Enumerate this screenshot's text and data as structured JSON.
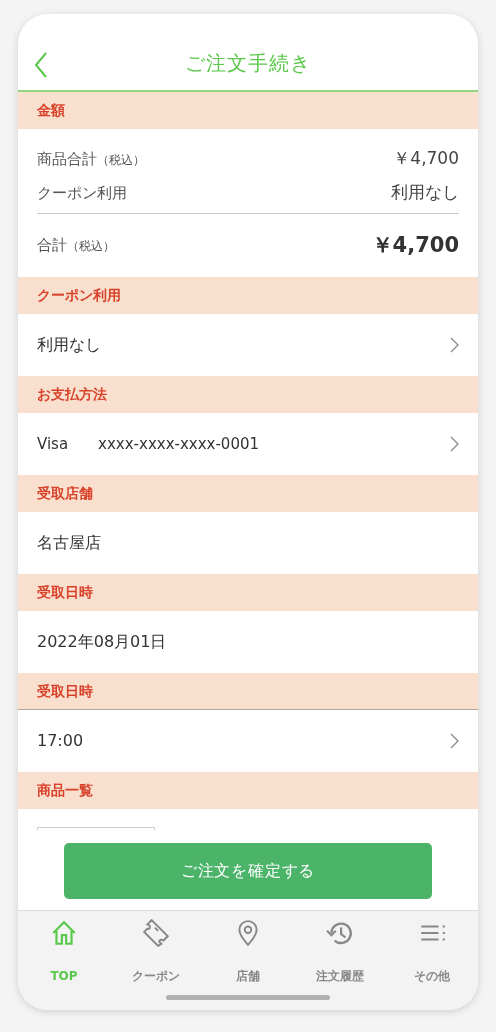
{
  "header": {
    "title": "ご注文手続き"
  },
  "amount": {
    "title": "金額",
    "lines": [
      {
        "label": "商品合計",
        "note": "（税込）",
        "value": "￥4,700"
      },
      {
        "label": "クーポン利用",
        "value": "利用なし"
      }
    ],
    "total": {
      "label": "合計",
      "note": "（税込）",
      "value": "￥4,700"
    }
  },
  "sections": [
    {
      "title": "クーポン利用",
      "values": [
        "利用なし"
      ],
      "chevron": true
    },
    {
      "title": "お支払方法",
      "values": [
        "Visa",
        "xxxx-xxxx-xxxx-0001"
      ],
      "chevron": true
    },
    {
      "title": "受取店舗",
      "values": [
        "名古屋店"
      ],
      "chevron": false
    },
    {
      "title": "受取日時",
      "values": [
        "2022年08月01日"
      ],
      "chevron": false
    },
    {
      "title": "受取日時",
      "values": [
        "17:00"
      ],
      "chevron": true
    },
    {
      "title": "商品一覧",
      "chevron": false
    }
  ],
  "confirm_button": "ご注文を確定する",
  "tabs": [
    {
      "kind": "home",
      "label": "TOP",
      "selected": true
    },
    {
      "kind": "ticket",
      "label": "クーポン",
      "selected": false
    },
    {
      "kind": "pin",
      "label": "店舗",
      "selected": false
    },
    {
      "kind": "history",
      "label": "注文履歴",
      "selected": false
    },
    {
      "kind": "menu",
      "label": "その他",
      "selected": false
    }
  ]
}
